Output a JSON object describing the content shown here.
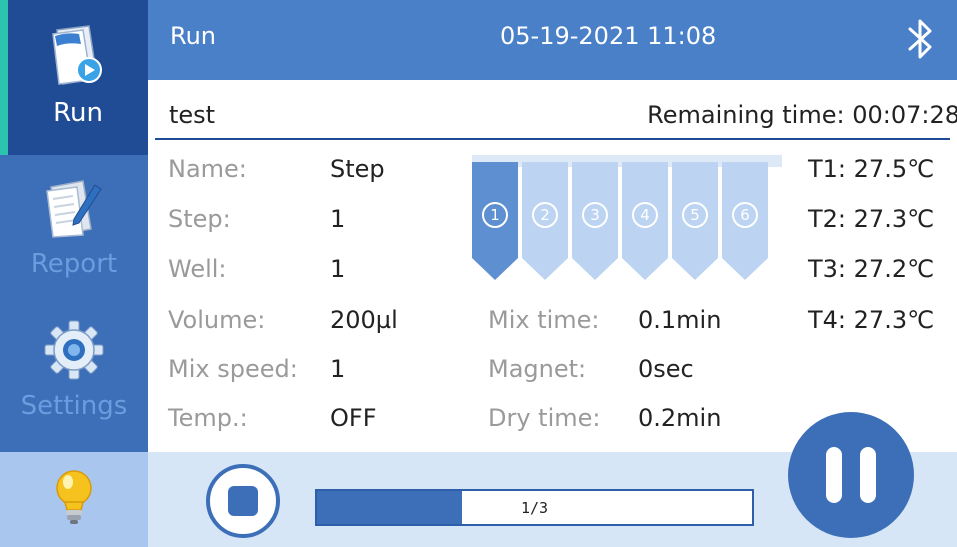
{
  "sidebar": {
    "items": [
      {
        "label": "Run",
        "icon": "run-document-icon"
      },
      {
        "label": "Report",
        "icon": "report-paper-icon"
      },
      {
        "label": "Settings",
        "icon": "gear-icon"
      },
      {
        "label": "",
        "icon": "lightbulb-icon"
      }
    ]
  },
  "header": {
    "title": "Run",
    "datetime": "05-19-2021 11:08",
    "bluetooth_icon": "bluetooth-icon"
  },
  "program": {
    "name": "test",
    "remaining_label": "Remaining time:",
    "remaining_value": "00:07:28"
  },
  "params": {
    "name_label": "Name:",
    "name_value": "Step",
    "step_label": "Step:",
    "step_value": "1",
    "well_label": "Well:",
    "well_value": "1",
    "volume_label": "Volume:",
    "volume_value": "200µl",
    "mixspeed_label": "Mix speed:",
    "mixspeed_value": "1",
    "temp_label": "Temp.:",
    "temp_value": "OFF",
    "mixtime_label": "Mix time:",
    "mixtime_value": "0.1min",
    "magnet_label": "Magnet:",
    "magnet_value": "0sec",
    "drytime_label": "Dry time:",
    "drytime_value": "0.2min"
  },
  "wells": [
    {
      "number": "1",
      "active": true
    },
    {
      "number": "2",
      "active": false
    },
    {
      "number": "3",
      "active": false
    },
    {
      "number": "4",
      "active": false
    },
    {
      "number": "5",
      "active": false
    },
    {
      "number": "6",
      "active": false
    }
  ],
  "temps": [
    {
      "label": "T1:",
      "value": "27.5℃"
    },
    {
      "label": "T2:",
      "value": "27.3℃"
    },
    {
      "label": "T3:",
      "value": "27.2℃"
    },
    {
      "label": "T4:",
      "value": "27.3℃"
    }
  ],
  "progress": {
    "text": "1/3",
    "fraction": 0.333
  },
  "controls": {
    "stop_icon": "stop-icon",
    "pause_icon": "pause-icon"
  },
  "colors": {
    "primary": "#3d6fb9",
    "header": "#4a80c8",
    "active_nav": "#1f4c94",
    "active_accent": "#2cc3b0",
    "well_active": "#5d8fd1",
    "well_inactive": "#bcd4f2"
  }
}
